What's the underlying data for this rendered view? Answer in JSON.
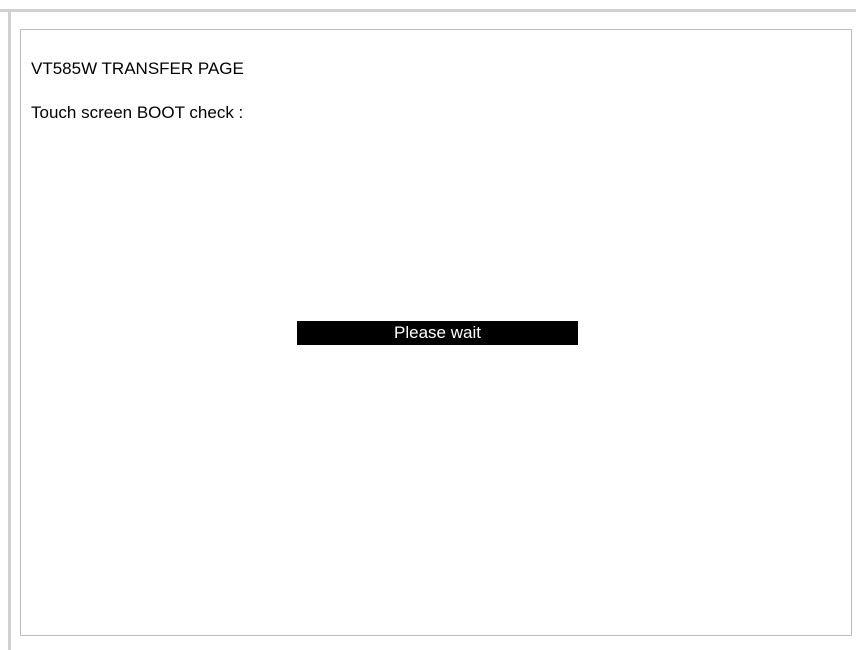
{
  "screen": {
    "title": "VT585W TRANSFER PAGE",
    "subtitle": "Touch screen BOOT check :",
    "status": "Please wait"
  },
  "colors": {
    "background": "#ffffff",
    "frame": "#d0d0d0",
    "panel_border": "#bcbcbc",
    "status_bg": "#000000",
    "status_text": "#ffffff",
    "text": "#000000"
  }
}
